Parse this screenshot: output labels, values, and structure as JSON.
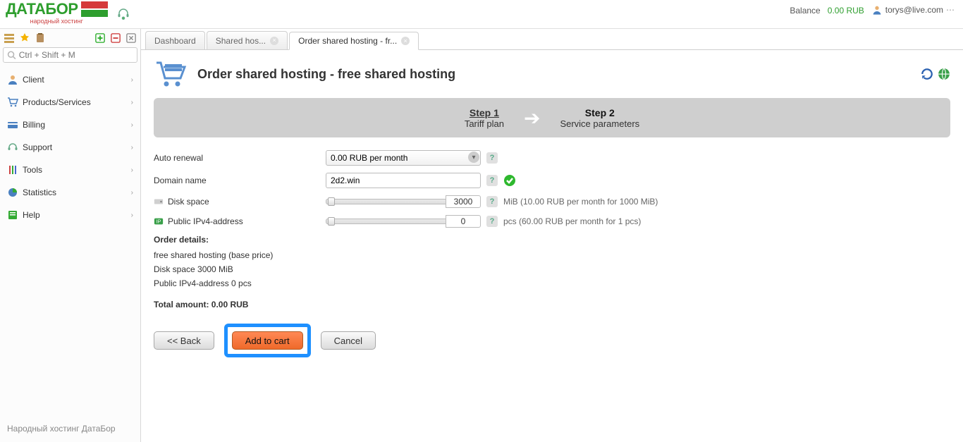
{
  "logo": {
    "text": "ДАТАБОР",
    "sub": "народный хостинг"
  },
  "topbar": {
    "balance_label": "Balance",
    "balance_value": "0.00 RUB",
    "user_email": "torys@live.com"
  },
  "search": {
    "placeholder": "Ctrl + Shift + M"
  },
  "sidebar": {
    "items": [
      {
        "label": "Client"
      },
      {
        "label": "Products/Services"
      },
      {
        "label": "Billing"
      },
      {
        "label": "Support"
      },
      {
        "label": "Tools"
      },
      {
        "label": "Statistics"
      },
      {
        "label": "Help"
      }
    ],
    "footer": "Народный хостинг ДатаБор"
  },
  "tabs": [
    {
      "label": "Dashboard",
      "closable": false
    },
    {
      "label": "Shared hos...",
      "closable": true
    },
    {
      "label": "Order shared hosting - fr...",
      "closable": true
    }
  ],
  "page": {
    "title": "Order shared hosting - free shared hosting"
  },
  "steps": {
    "s1": {
      "label": "Step 1",
      "sub": "Tariff plan"
    },
    "s2": {
      "label": "Step 2",
      "sub": "Service parameters"
    }
  },
  "form": {
    "auto_renewal": {
      "label": "Auto renewal",
      "value": "0.00 RUB per month"
    },
    "domain": {
      "label": "Domain name",
      "value": "2d2.win"
    },
    "disk": {
      "label": "Disk space",
      "value": "3000",
      "hint": "MiB (10.00 RUB per month for 1000 MiB)"
    },
    "ipv4": {
      "label": "Public IPv4-address",
      "value": "0",
      "hint": "pcs (60.00 RUB per month for 1 pcs)"
    }
  },
  "order": {
    "title": "Order details:",
    "lines": [
      "free shared hosting (base price)",
      "Disk space 3000 MiB",
      "Public IPv4-address 0 pcs"
    ],
    "total": "Total amount: 0.00 RUB"
  },
  "buttons": {
    "back": "<< Back",
    "add": "Add to cart",
    "cancel": "Cancel"
  }
}
